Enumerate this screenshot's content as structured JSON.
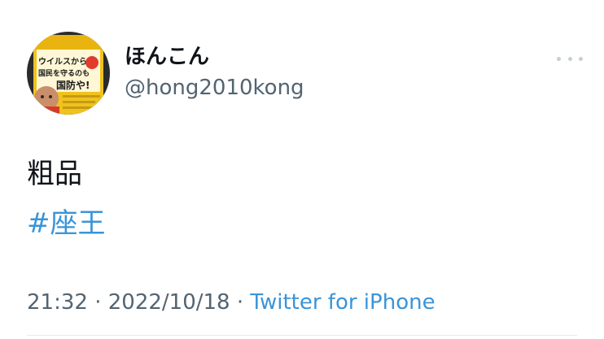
{
  "tweet": {
    "author": {
      "display_name": "ほんこん",
      "handle": "@hong2010kong",
      "avatar_book_text": [
        "ウイルスから",
        "国民を守るのも",
        "国防や!"
      ]
    },
    "text": "粗品",
    "hashtag": "#座王",
    "time": "21:32",
    "separator": "·",
    "date": "2022/10/18",
    "source": "Twitter for iPhone"
  },
  "colors": {
    "link": "#3a94d8",
    "secondary": "#536471",
    "primary": "#0f1419"
  }
}
